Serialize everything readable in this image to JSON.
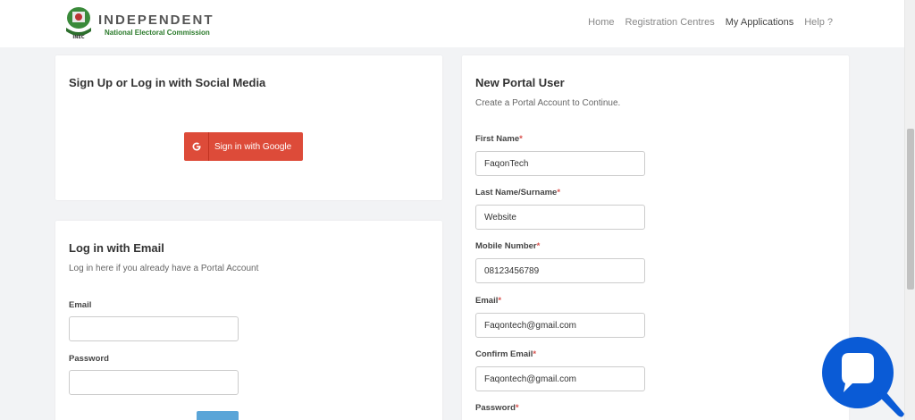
{
  "header": {
    "org_name": "INDEPENDENT",
    "org_sub": "National Electoral Commission",
    "nav": [
      "Home",
      "Registration Centres",
      "My Applications",
      "Help ?"
    ]
  },
  "social": {
    "title": "Sign Up or Log in with Social Media",
    "google_label": "Sign in with Google"
  },
  "login": {
    "title": "Log in with Email",
    "subtitle": "Log in here if you already have a Portal Account",
    "email_label": "Email",
    "password_label": "Password",
    "email_value": "",
    "password_value": ""
  },
  "register": {
    "title": "New Portal User",
    "subtitle": "Create a Portal Account to Continue.",
    "first_name_label": "First Name",
    "first_name_value": "FaqonTech",
    "last_name_label": "Last Name/Surname",
    "last_name_value": "Website",
    "mobile_label": "Mobile Number",
    "mobile_value": "08123456789",
    "email_label": "Email",
    "email_value": "Faqontech@gmail.com",
    "confirm_email_label": "Confirm Email",
    "confirm_email_value": "Faqontech@gmail.com",
    "password_label": "Password",
    "required_mark": "*"
  },
  "colors": {
    "google": "#dd4b39",
    "chat": "#0a5bd6",
    "brand_green": "#2a7a2a"
  }
}
